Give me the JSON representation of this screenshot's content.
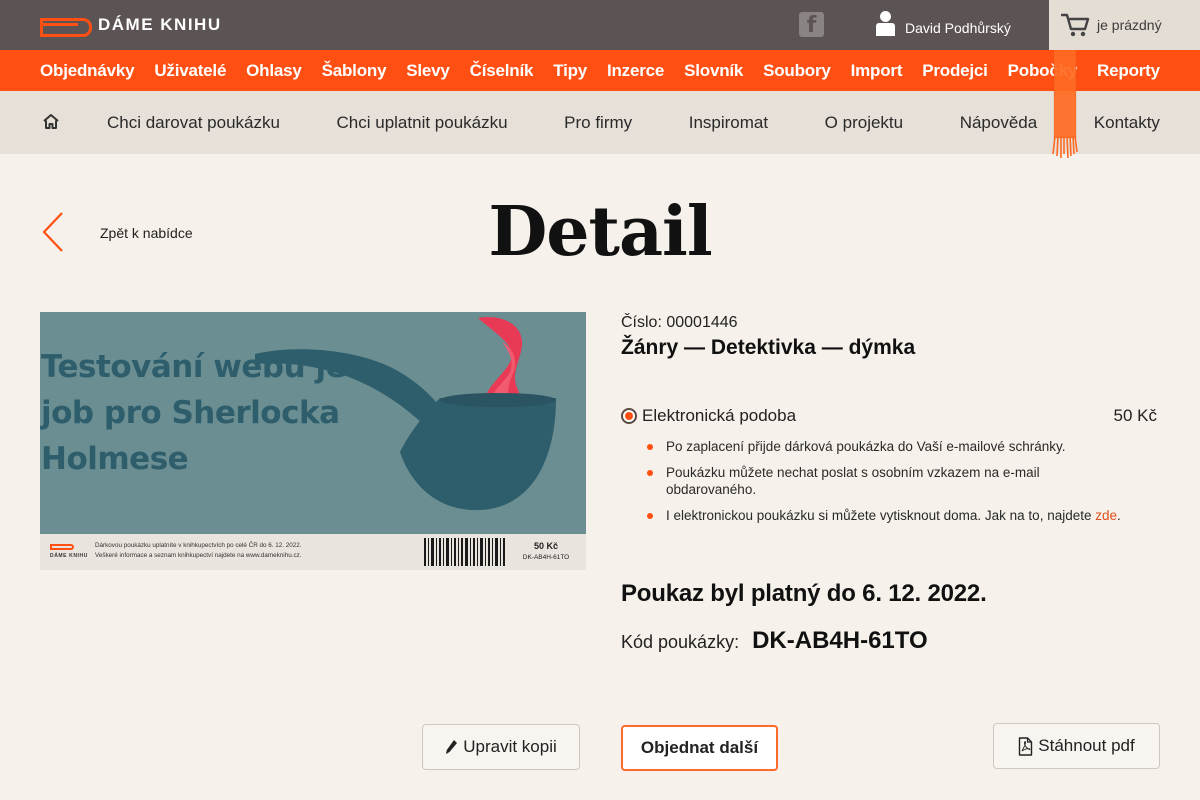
{
  "header": {
    "logo_text": "DÁME KNIHU",
    "facebook_glyph": "f",
    "user_name": "David Podhůrský",
    "cart_text": "je prázdný"
  },
  "admin_nav": [
    "Objednávky",
    "Uživatelé",
    "Ohlasy",
    "Šablony",
    "Slevy",
    "Číselník",
    "Tipy",
    "Inzerce",
    "Slovník",
    "Soubory",
    "Import",
    "Prodejci",
    "Pobočky",
    "Reporty"
  ],
  "main_nav": [
    "Chci darovat poukázku",
    "Chci uplatnit poukázku",
    "Pro firmy",
    "Inspiromat",
    "O projektu",
    "Nápověda",
    "Kontakty"
  ],
  "page": {
    "back_label": "Zpět k nabídce",
    "title": "Detail"
  },
  "voucher": {
    "slogan": "Testování webu je job pro Sherlocka Holmese",
    "footer_logo": "DÁME KNIHU",
    "footer_line1": "Dárkovou poukázku uplatníte v knihkupectvích po celé ČR do 6. 12. 2022.",
    "footer_line2": "Veškeré informace a seznam knihkupectví najdete na www.dameknihu.cz.",
    "price": "50 Kč",
    "code": "DK-AB4H-61TO"
  },
  "detail": {
    "number": "Číslo: 00001446",
    "genre": "Žánry — Detektivka — dýmka",
    "option_label": "Elektronická podoba",
    "option_price": "50 Kč",
    "bullet1": "Po zaplacení přijde dárková poukázka do Vaší e-mailové schránky.",
    "bullet2": "Poukázku můžete nechat poslat s osobním vzkazem na e-mail obdarovaného.",
    "bullet3_text": "I elektronickou poukázku si můžete vytisknout doma. Jak na to, najdete ",
    "bullet3_link": "zde",
    "bullet3_end": ".",
    "validity": "Poukaz byl platný do 6. 12. 2022.",
    "code_label": "Kód poukázky:",
    "code_value": "DK-AB4H-61TO"
  },
  "buttons": {
    "edit_copy": "Upravit kopii",
    "order_more": "Objednat další",
    "download_pdf": "Stáhnout pdf"
  },
  "colors": {
    "accent": "#ff4f12",
    "topbar": "#5c5454",
    "voucher_bg": "#6a8e92",
    "voucher_dark": "#2e5d6b",
    "flame": "#e83a55"
  },
  "icons": [
    "logo-mark",
    "facebook-icon",
    "user-icon",
    "cart-icon",
    "home-icon",
    "bookmark-ribbon",
    "chevron-left-icon",
    "pencil-icon",
    "pdf-icon"
  ]
}
